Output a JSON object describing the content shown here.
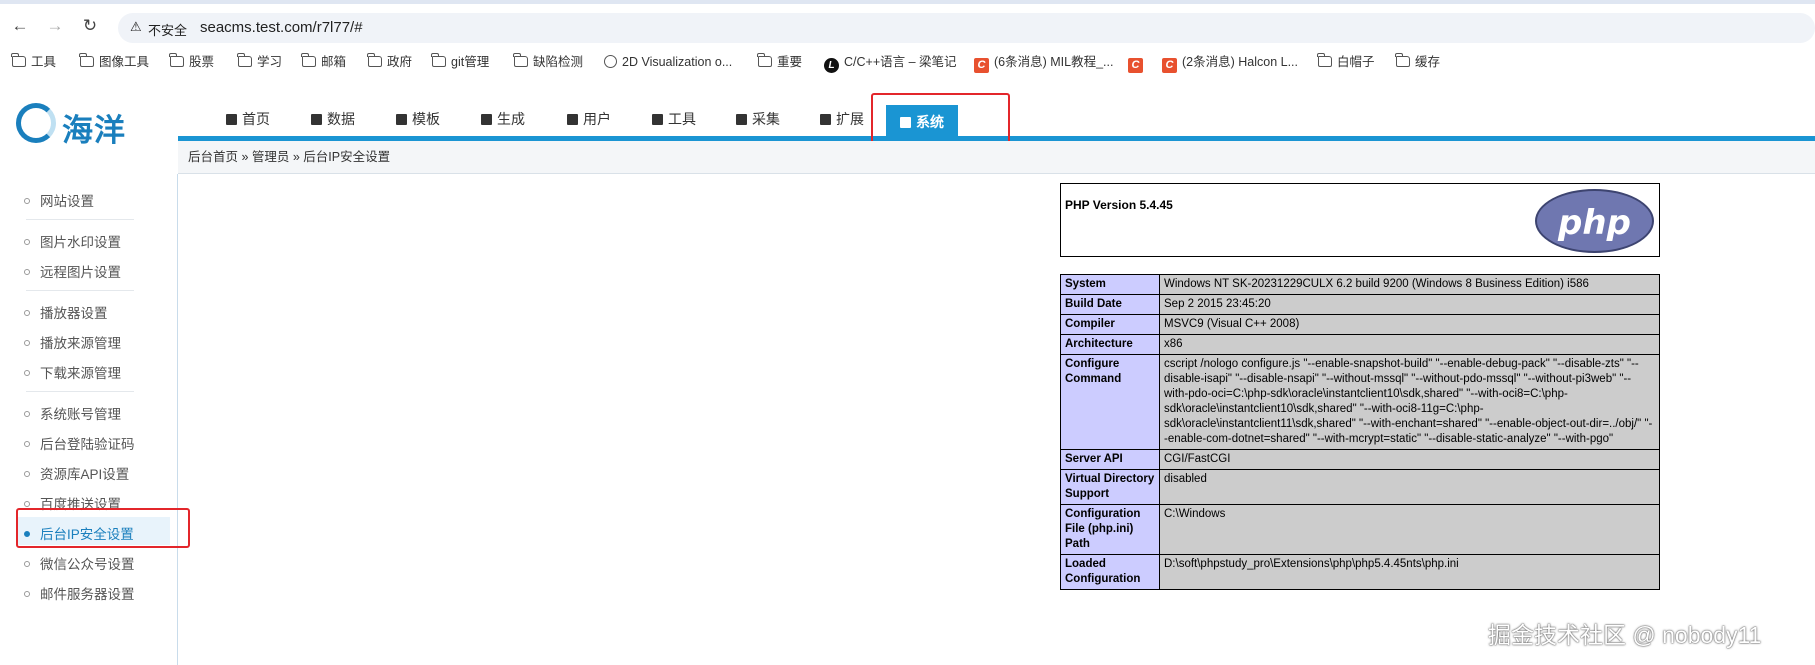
{
  "browser": {
    "security_label": "不安全",
    "url": "seacms.test.com/r7l77/#",
    "bookmarks": [
      {
        "label": "工具",
        "icon": "folder-icon"
      },
      {
        "label": "图像工具",
        "icon": "folder-icon"
      },
      {
        "label": "股票",
        "icon": "folder-icon"
      },
      {
        "label": "学习",
        "icon": "folder-icon"
      },
      {
        "label": "邮箱",
        "icon": "folder-icon"
      },
      {
        "label": "政府",
        "icon": "folder-icon"
      },
      {
        "label": "git管理",
        "icon": "folder-icon"
      },
      {
        "label": "缺陷检测",
        "icon": "folder-icon"
      },
      {
        "label": "2D Visualization o...",
        "icon": "globe-icon"
      },
      {
        "label": "重要",
        "icon": "folder-icon"
      },
      {
        "label": "C/C++语言 – 梁笔记",
        "icon": "site-l-icon"
      },
      {
        "label": "(6条消息) MIL教程_...",
        "icon": "site-c-icon"
      },
      {
        "label": "",
        "icon": "site-c-icon"
      },
      {
        "label": "(2条消息) Halcon L...",
        "icon": "site-c-icon"
      },
      {
        "label": "白帽子",
        "icon": "folder-icon"
      },
      {
        "label": "缓存",
        "icon": "folder-icon"
      }
    ]
  },
  "app": {
    "logo_text": "海洋",
    "nav": [
      "首页",
      "数据",
      "模板",
      "生成",
      "用户",
      "工具",
      "采集",
      "扩展",
      "系统"
    ],
    "active_nav": "系统",
    "breadcrumb": "后台首页 » 管理员 » 后台IP安全设置"
  },
  "sidebar": {
    "items": [
      "网站设置",
      "图片水印设置",
      "远程图片设置",
      "播放器设置",
      "播放来源管理",
      "下载来源管理",
      "系统账号管理",
      "后台登陆验证码",
      "资源库API设置",
      "百度推送设置",
      "后台IP安全设置",
      "微信公众号设置",
      "邮件服务器设置"
    ],
    "active": "后台IP安全设置"
  },
  "phpinfo": {
    "version": "PHP Version 5.4.45",
    "logo": "php",
    "rows": [
      {
        "k": "System",
        "v": "Windows NT SK-20231229CULX 6.2 build 9200 (Windows 8 Business Edition) i586"
      },
      {
        "k": "Build Date",
        "v": "Sep 2 2015 23:45:20"
      },
      {
        "k": "Compiler",
        "v": "MSVC9 (Visual C++ 2008)"
      },
      {
        "k": "Architecture",
        "v": "x86"
      },
      {
        "k": "Configure Command",
        "v": "cscript /nologo configure.js \"--enable-snapshot-build\" \"--enable-debug-pack\" \"--disable-zts\" \"--disable-isapi\" \"--disable-nsapi\" \"--without-mssql\" \"--without-pdo-mssql\" \"--without-pi3web\" \"--with-pdo-oci=C:\\php-sdk\\oracle\\instantclient10\\sdk,shared\" \"--with-oci8=C:\\php-sdk\\oracle\\instantclient10\\sdk,shared\" \"--with-oci8-11g=C:\\php-sdk\\oracle\\instantclient11\\sdk,shared\" \"--with-enchant=shared\" \"--enable-object-out-dir=../obj/\" \"--enable-com-dotnet=shared\" \"--with-mcrypt=static\" \"--disable-static-analyze\" \"--with-pgo\""
      },
      {
        "k": "Server API",
        "v": "CGI/FastCGI"
      },
      {
        "k": "Virtual Directory Support",
        "v": "disabled"
      },
      {
        "k": "Configuration File (php.ini) Path",
        "v": "C:\\Windows"
      },
      {
        "k": "Loaded Configuration",
        "v": "D:\\soft\\phpstudy_pro\\Extensions\\php\\php5.4.45nts\\php.ini"
      }
    ]
  },
  "watermark": "掘金技术社区 @ nobody11",
  "colors": {
    "accent": "#1a95d3",
    "highlight": "#e3262b",
    "php_key": "#ccccff",
    "php_val": "#cccccc"
  }
}
